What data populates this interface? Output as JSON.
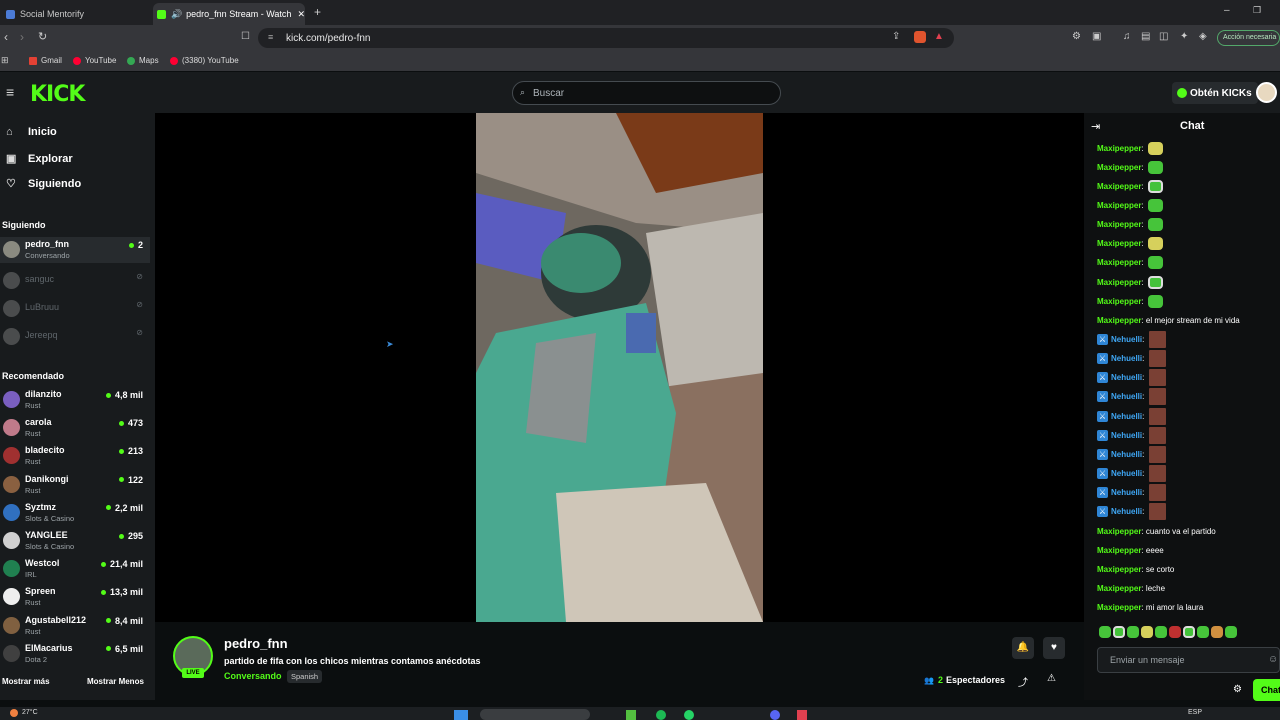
{
  "browser": {
    "tabs": [
      {
        "title": "Social Mentorify"
      },
      {
        "title": "pedro_fnn Stream - Watch Li"
      }
    ],
    "url": "kick.com/pedro-fnn",
    "action_button": "Acción necesaria",
    "bookmarks": [
      "Gmail",
      "YouTube",
      "Maps",
      "(3380) YouTube"
    ]
  },
  "header": {
    "logo": "KICK",
    "search_placeholder": "Buscar",
    "get_kicks": "Obtén KICKs"
  },
  "sidebar": {
    "nav": [
      {
        "label": "Inicio",
        "icon": "home-icon"
      },
      {
        "label": "Explorar",
        "icon": "compass-icon"
      },
      {
        "label": "Siguiendo",
        "icon": "heart-icon"
      }
    ],
    "following_title": "Siguiendo",
    "following": [
      {
        "name": "pedro_fnn",
        "category": "Conversando",
        "viewers": "2",
        "live": true
      },
      {
        "name": "sanguc",
        "live": false
      },
      {
        "name": "LuBruuu",
        "live": false
      },
      {
        "name": "Jereepq",
        "live": false
      }
    ],
    "recommended_title": "Recomendado",
    "recommended": [
      {
        "name": "dilanzito",
        "category": "Rust",
        "viewers": "4,8 mil",
        "color": "#7a5fc0"
      },
      {
        "name": "carola",
        "category": "Rust",
        "viewers": "473",
        "color": "#c07a8a"
      },
      {
        "name": "bladecito",
        "category": "Rust",
        "viewers": "213",
        "color": "#a03030"
      },
      {
        "name": "Danikongi",
        "category": "Rust",
        "viewers": "122",
        "color": "#8a6040"
      },
      {
        "name": "Syztmz",
        "category": "Slots & Casino",
        "viewers": "2,2 mil",
        "color": "#3070c0"
      },
      {
        "name": "YANGLEE",
        "category": "Slots & Casino",
        "viewers": "295",
        "color": "#d0d0d0"
      },
      {
        "name": "Westcol",
        "category": "IRL",
        "viewers": "21,4 mil",
        "color": "#208050"
      },
      {
        "name": "Spreen",
        "category": "Rust",
        "viewers": "13,3 mil",
        "color": "#eeeeee"
      },
      {
        "name": "Agustabell212",
        "category": "Rust",
        "viewers": "8,4 mil",
        "color": "#806040"
      },
      {
        "name": "ElMacarius",
        "category": "Dota 2",
        "viewers": "6,5 mil",
        "color": "#404040"
      }
    ],
    "show_more": "Mostrar más",
    "show_less": "Mostrar Menos"
  },
  "stream": {
    "channel": "pedro_fnn",
    "title": "partido de fifa con los chicos mientras contamos anécdotas",
    "category": "Conversando",
    "language": "Spanish",
    "live_label": "LIVE",
    "viewers_count": "2",
    "viewers_label": "Espectadores"
  },
  "chat": {
    "title": "Chat",
    "messages": [
      {
        "user": "Maxipepper",
        "emote": "em-y"
      },
      {
        "user": "Maxipepper",
        "emote": "em-g"
      },
      {
        "user": "Maxipepper",
        "emote": "em-m"
      },
      {
        "user": "Maxipepper",
        "emote": "em-g"
      },
      {
        "user": "Maxipepper",
        "emote": "em-g"
      },
      {
        "user": "Maxipepper",
        "emote": "em-y"
      },
      {
        "user": "Maxipepper",
        "emote": "em-g"
      },
      {
        "user": "Maxipepper",
        "emote": "em-m"
      },
      {
        "user": "Maxipepper",
        "emote": "em-g"
      },
      {
        "user": "Maxipepper",
        "text": "el mejor stream de mi vida"
      },
      {
        "user": "Nehuelli",
        "emote": "em-f",
        "mod": true
      },
      {
        "user": "Nehuelli",
        "emote": "em-f",
        "mod": true
      },
      {
        "user": "Nehuelli",
        "emote": "em-f",
        "mod": true
      },
      {
        "user": "Nehuelli",
        "emote": "em-f",
        "mod": true
      },
      {
        "user": "Nehuelli",
        "emote": "em-f",
        "mod": true
      },
      {
        "user": "Nehuelli",
        "emote": "em-f",
        "mod": true
      },
      {
        "user": "Nehuelli",
        "emote": "em-f",
        "mod": true
      },
      {
        "user": "Nehuelli",
        "emote": "em-f",
        "mod": true
      },
      {
        "user": "Nehuelli",
        "emote": "em-f",
        "mod": true
      },
      {
        "user": "Nehuelli",
        "emote": "em-f",
        "mod": true
      },
      {
        "user": "Maxipepper",
        "text": "cuanto va el partido"
      },
      {
        "user": "Maxipepper",
        "text": "eeee"
      },
      {
        "user": "Maxipepper",
        "text": "se corto"
      },
      {
        "user": "Maxipepper",
        "text": "leche"
      },
      {
        "user": "Maxipepper",
        "text": "mi amor la laura"
      }
    ],
    "input_placeholder": "Enviar un mensaje",
    "send_label": "Chat"
  },
  "taskbar": {
    "temperature": "27°C",
    "language": "ESP"
  },
  "colors": {
    "accent": "#53fc18",
    "background": "#0b0e0f",
    "panel": "#181b1d"
  }
}
